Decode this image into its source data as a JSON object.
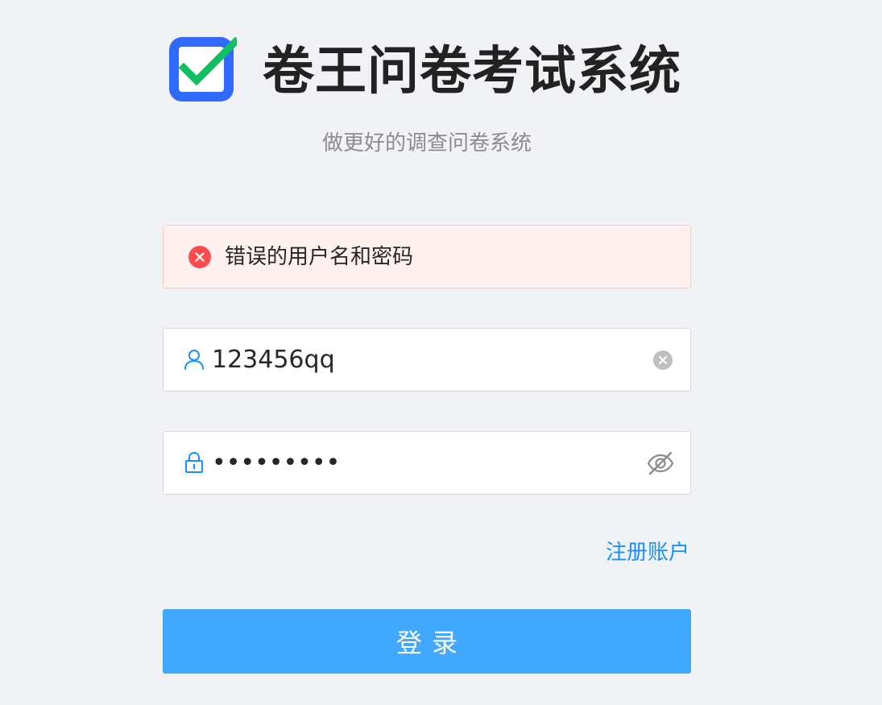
{
  "app": {
    "title": "卷王问卷考试系统",
    "subtitle": "做更好的调查问卷系统",
    "logo_icon": "checkbox-checked-icon"
  },
  "alert": {
    "type": "error",
    "message": "错误的用户名和密码",
    "icon": "close-circle-icon"
  },
  "form": {
    "username": {
      "value": "123456qq",
      "prefix_icon": "user-icon",
      "suffix_icon": "clear-icon"
    },
    "password": {
      "value": "•••••••••",
      "prefix_icon": "lock-icon",
      "suffix_icon": "eye-invisible-icon"
    },
    "register_label": "注册账户",
    "login_label": "登录"
  },
  "colors": {
    "background": "#f0f2f5",
    "primary": "#1890ff",
    "button": "#40a9ff",
    "error": "#ff4d4f",
    "logo_blue": "#2f6bff",
    "logo_green": "#11c060"
  }
}
